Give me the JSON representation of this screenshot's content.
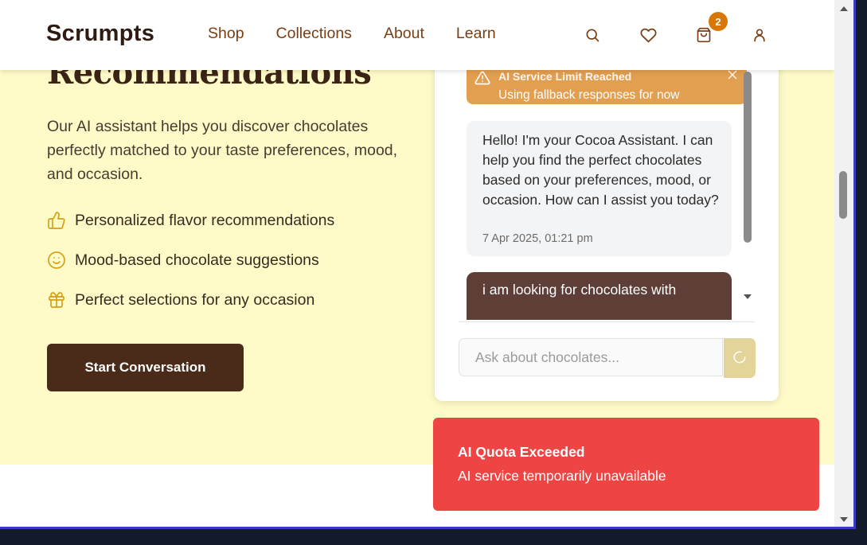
{
  "header": {
    "logo": "Scrumpts",
    "nav": [
      "Shop",
      "Collections",
      "About",
      "Learn"
    ],
    "icons": [
      "search-icon",
      "heart-icon",
      "bag-icon",
      "user-icon"
    ],
    "cart_count": "2"
  },
  "hero": {
    "title": "Recommendations",
    "description": "Our AI assistant helps you discover chocolates perfectly matched to your taste preferences, mood, and occasion.",
    "features": [
      {
        "icon": "thumbs-up-icon",
        "label": "Personalized flavor recommendations"
      },
      {
        "icon": "smile-icon",
        "label": "Mood-based chocolate suggestions"
      },
      {
        "icon": "gift-icon",
        "label": "Perfect selections for any occasion"
      }
    ],
    "cta_label": "Start Conversation"
  },
  "chat": {
    "warning_title": "AI Service Limit Reached",
    "warning_text": "Using fallback responses for now",
    "bot_message": "Hello! I'm your Cocoa Assistant. I can help you find the perfect chocolates based on your preferences, mood, or occasion. How can I assist you today?",
    "bot_time": "7 Apr 2025, 01:21 pm",
    "user_message": "i am looking for chocolates with",
    "input_placeholder": "Ask about chocolates..."
  },
  "toast": {
    "title": "AI Quota Exceeded",
    "text": "AI service temporarily unavailable"
  },
  "colors": {
    "brand_dark": "#4a2a18",
    "nav_text": "#7a3e12",
    "hero_bg": "#fefbc8",
    "badge": "#d97706",
    "warning_bg": "#e39f50",
    "toast_bg": "#ef4444",
    "user_bubble": "#5e3f37"
  }
}
